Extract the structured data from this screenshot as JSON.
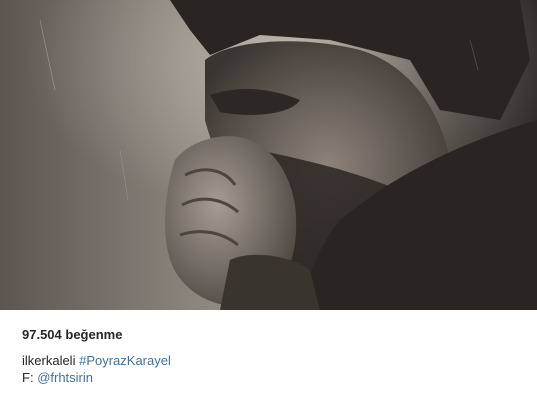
{
  "post": {
    "photo_description_icon": "photo",
    "likes_text": "97.504 beğenme",
    "caption": {
      "username": "ilkerkaleli",
      "hashtag": "#PoyrazKarayel"
    },
    "credit": {
      "prefix": "F:",
      "mention": "@frhtsirin"
    }
  },
  "colors": {
    "link": "#3f729b",
    "text": "#262626",
    "photo_tone": "#6f6862"
  }
}
